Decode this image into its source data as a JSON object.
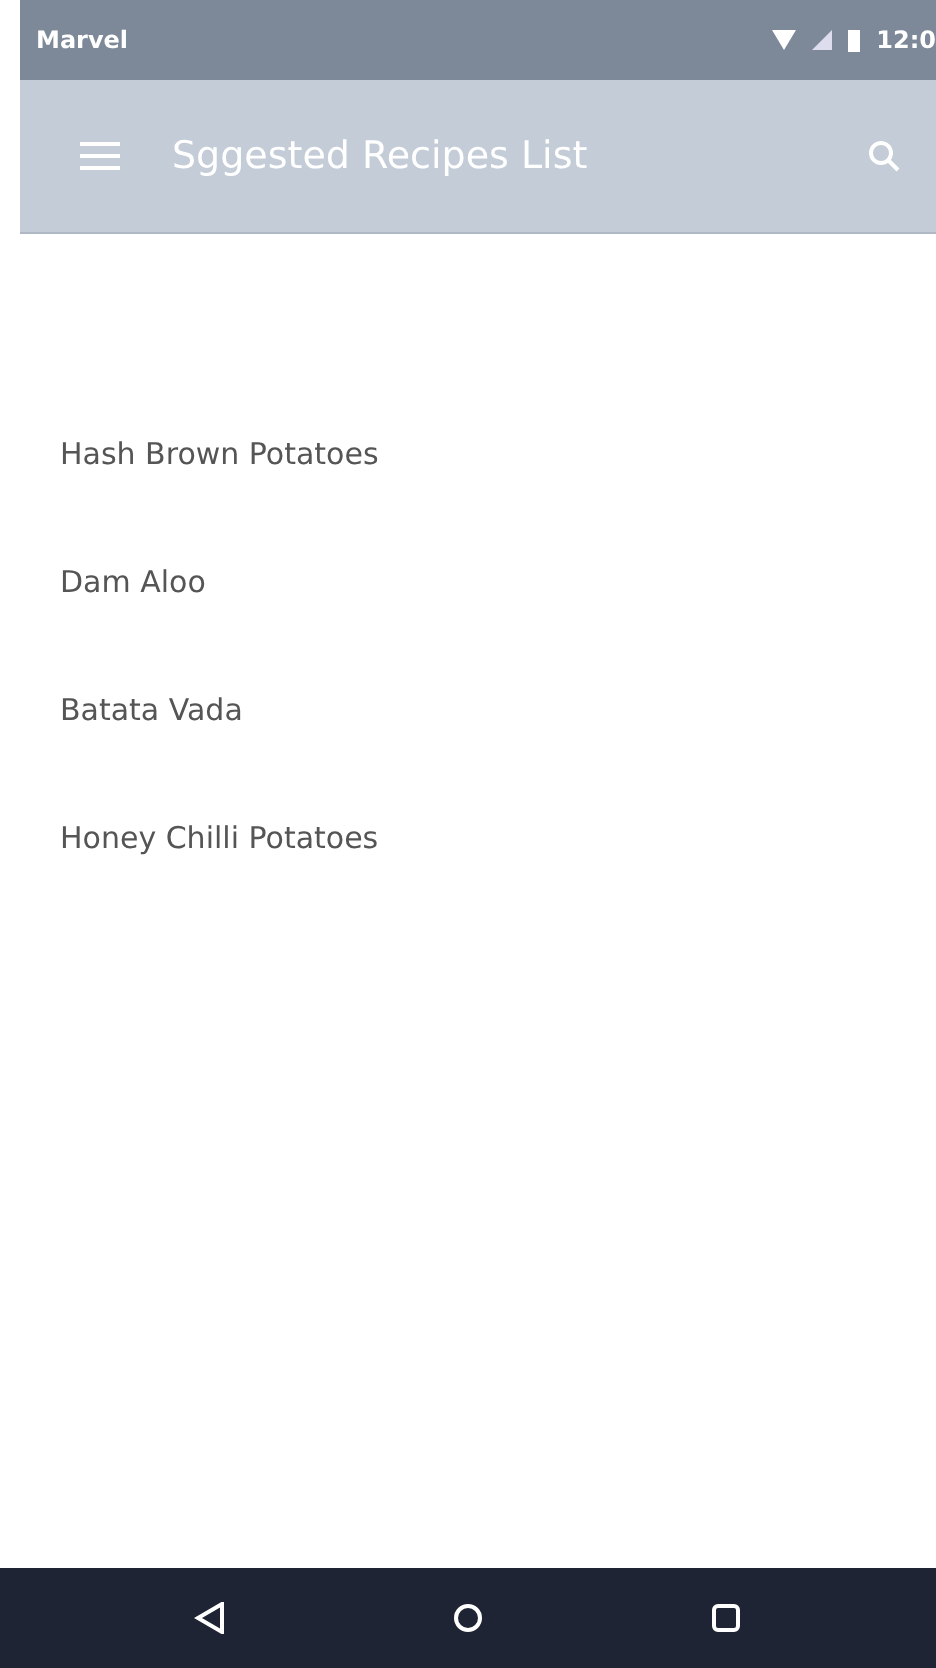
{
  "status_bar": {
    "carrier": "Marvel",
    "time": "12:0"
  },
  "app_bar": {
    "title": "Sggested Recipes List"
  },
  "recipes": [
    {
      "name": "Hash Brown Potatoes"
    },
    {
      "name": "Dam Aloo"
    },
    {
      "name": "Batata Vada"
    },
    {
      "name": "Honey Chilli Potatoes"
    }
  ]
}
